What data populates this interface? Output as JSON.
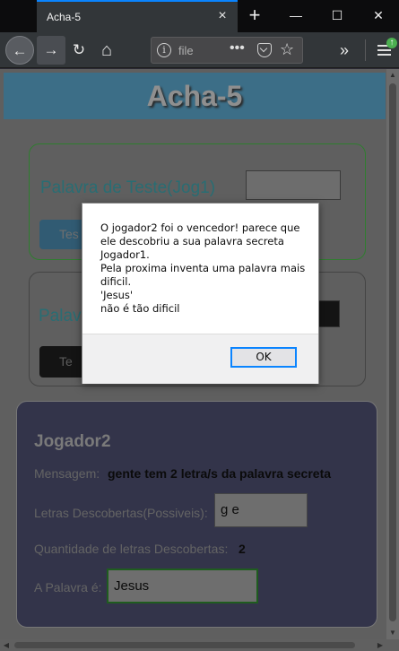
{
  "browser": {
    "tab_title": "Acha-5",
    "url_text": "file",
    "icons": {
      "tab_close": "×",
      "new_tab": "+",
      "minimize": "—",
      "maximize": "☐",
      "close": "✕",
      "back": "←",
      "forward": "→",
      "reload": "↻",
      "home": "⌂",
      "info": "i",
      "page_actions": "•••",
      "bookmark": "☆",
      "overflow": "»",
      "update": "↑"
    }
  },
  "page": {
    "title": "Acha-5",
    "player1_card": {
      "label": "Palavra de Teste(Jog1)",
      "button_label": "Tes"
    },
    "player2_entry_card": {
      "label": "Palav",
      "button_label": "Te"
    },
    "player2_panel": {
      "title": "Jogador2",
      "message_label": "Mensagem:",
      "message": "gente tem 2 letra/s da palavra secreta",
      "letters_label": "Letras Descobertas(Possiveis):",
      "letters_value": "g e",
      "count_label": "Quantidade de letras Descobertas:",
      "count_value": "2",
      "word_label": "A Palavra é:",
      "word_value": "Jesus"
    }
  },
  "dialog": {
    "message": "O jogador2 foi o vencedor! parece que ele descobriu a sua palavra secreta Jogador1.\n Pela proxima inventa uma palavra mais dificil.\n 'Jesus'\n não é tão dificil",
    "ok_label": "OK"
  },
  "colors": {
    "accent": "#0a84ff",
    "header_bg": "#3c6e87",
    "card_border_green": "#2f7d2f",
    "label_teal": "#296d73",
    "player2_bg": "#33344a"
  }
}
